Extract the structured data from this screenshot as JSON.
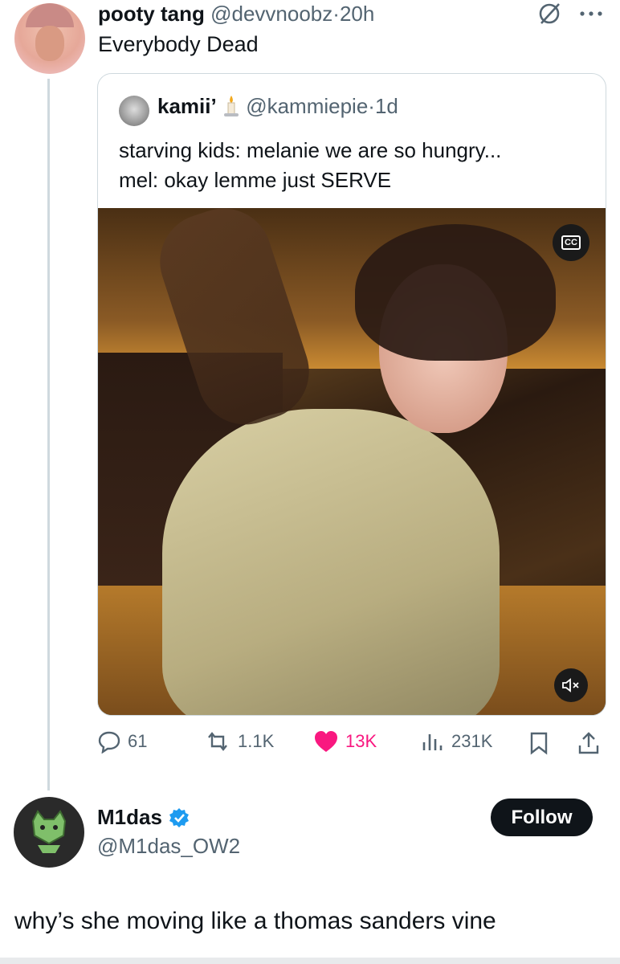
{
  "main_tweet": {
    "display_name": "pooty tang",
    "handle": "@devvnoobz",
    "separator": "·",
    "time": "20h",
    "text": "Everybody Dead"
  },
  "quoted_tweet": {
    "display_name": "kamii’",
    "handle": "@kammiepie",
    "separator": "·",
    "time": "1d",
    "line1": "starving kids: melanie we are so hungry...",
    "line2": "mel: okay lemme just SERVE",
    "cc_label": "CC"
  },
  "actions": {
    "replies": "61",
    "reposts": "1.1K",
    "likes": "13K",
    "views": "231K"
  },
  "reply_tweet": {
    "display_name": "M1das",
    "handle": "@M1das_OW2",
    "follow_label": "Follow",
    "text": "why’s she moving like a thomas sanders vine"
  },
  "colors": {
    "like": "#f91880",
    "verified": "#1d9bf0",
    "muted": "#536471"
  },
  "icons": [
    "grok-icon",
    "more-icon",
    "candle-emoji",
    "cc-icon",
    "mute-icon",
    "reply-icon",
    "repost-icon",
    "heart-icon",
    "views-icon",
    "bookmark-icon",
    "share-icon",
    "verified-icon"
  ]
}
